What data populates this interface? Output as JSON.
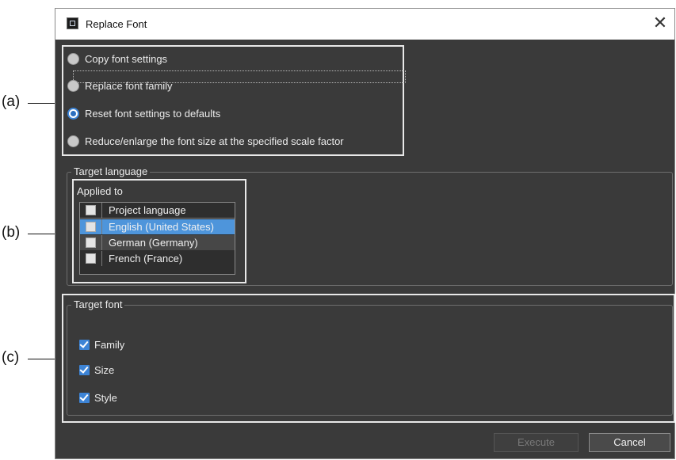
{
  "annotations": {
    "a": "(a)",
    "b": "(b)",
    "c": "(c)"
  },
  "dialog": {
    "title": "Replace Font",
    "close_symbol": "✕",
    "icon": "app-icon"
  },
  "mode_options": [
    {
      "label": "Copy font settings",
      "checked": false
    },
    {
      "label": "Replace font family",
      "checked": false
    },
    {
      "label": "Reset font settings to defaults",
      "checked": true
    },
    {
      "label": "Reduce/enlarge the font size at the specified scale factor",
      "checked": false
    }
  ],
  "target_language": {
    "group_title": "Target language",
    "list_caption": "Applied to",
    "header": "Project language",
    "rows": [
      {
        "label": "English (United States)",
        "checked": false,
        "selected": true
      },
      {
        "label": "German (Germany)",
        "checked": false,
        "selected": false
      },
      {
        "label": "French (France)",
        "checked": false,
        "selected": false
      }
    ]
  },
  "target_font": {
    "group_title": "Target font",
    "options": [
      {
        "label": "Family",
        "checked": true
      },
      {
        "label": "Size",
        "checked": true
      },
      {
        "label": "Style",
        "checked": true
      }
    ]
  },
  "buttons": {
    "execute": "Execute",
    "cancel": "Cancel"
  },
  "colors": {
    "dialog_bg": "#3a3a3a",
    "accent": "#3d84d6",
    "selection": "#4e95db"
  }
}
